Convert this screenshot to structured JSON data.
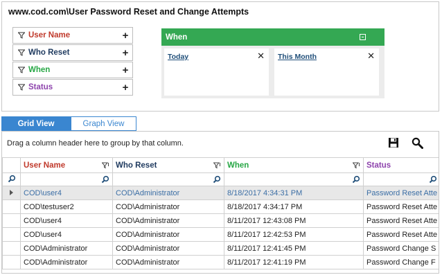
{
  "report": {
    "title": "www.cod.com\\User Password Reset and Change Attempts"
  },
  "filters": [
    {
      "label": "User Name",
      "color": "#c0392b"
    },
    {
      "label": "Who Reset",
      "color": "#1f3a5f"
    },
    {
      "label": "When",
      "color": "#27a745"
    },
    {
      "label": "Status",
      "color": "#8e44ad"
    }
  ],
  "when_panel": {
    "title": "When",
    "header_color": "#34a853",
    "cards": [
      {
        "label": "Today"
      },
      {
        "label": "This Month"
      }
    ]
  },
  "tabs": [
    {
      "label": "Grid View",
      "active": true
    },
    {
      "label": "Graph View",
      "active": false
    }
  ],
  "grid": {
    "drag_hint": "Drag a column header here to group by that column.",
    "columns": [
      {
        "label": "User Name",
        "color": "#c0392b"
      },
      {
        "label": "Who Reset",
        "color": "#1f3a5f"
      },
      {
        "label": "When",
        "color": "#27a745"
      },
      {
        "label": "Status",
        "color": "#8e44ad"
      }
    ],
    "rows": [
      {
        "user": "COD\\user4",
        "who": "COD\\Administrator",
        "when": "8/18/2017 4:34:31 PM",
        "status": "Password Reset Atte",
        "selected": true
      },
      {
        "user": "COD\\testuser2",
        "who": "COD\\Administrator",
        "when": "8/18/2017 4:34:17 PM",
        "status": "Password Reset Atte",
        "selected": false
      },
      {
        "user": "COD\\user4",
        "who": "COD\\Administrator",
        "when": "8/11/2017 12:43:08 PM",
        "status": "Password Reset Atte",
        "selected": false
      },
      {
        "user": "COD\\user4",
        "who": "COD\\Administrator",
        "when": "8/11/2017 12:42:53 PM",
        "status": "Password Reset Atte",
        "selected": false
      },
      {
        "user": "COD\\Administrator",
        "who": "COD\\Administrator",
        "when": "8/11/2017 12:41:45 PM",
        "status": "Password Change S",
        "selected": false
      },
      {
        "user": "COD\\Administrator",
        "who": "COD\\Administrator",
        "when": "8/11/2017 12:41:19 PM",
        "status": "Password Change F",
        "selected": false
      }
    ]
  },
  "icons": {
    "filter": "funnel-icon",
    "add": "plus-icon",
    "close": "close-icon",
    "save": "save-icon",
    "search": "search-icon",
    "row_indicator": "row-arrow-icon"
  }
}
